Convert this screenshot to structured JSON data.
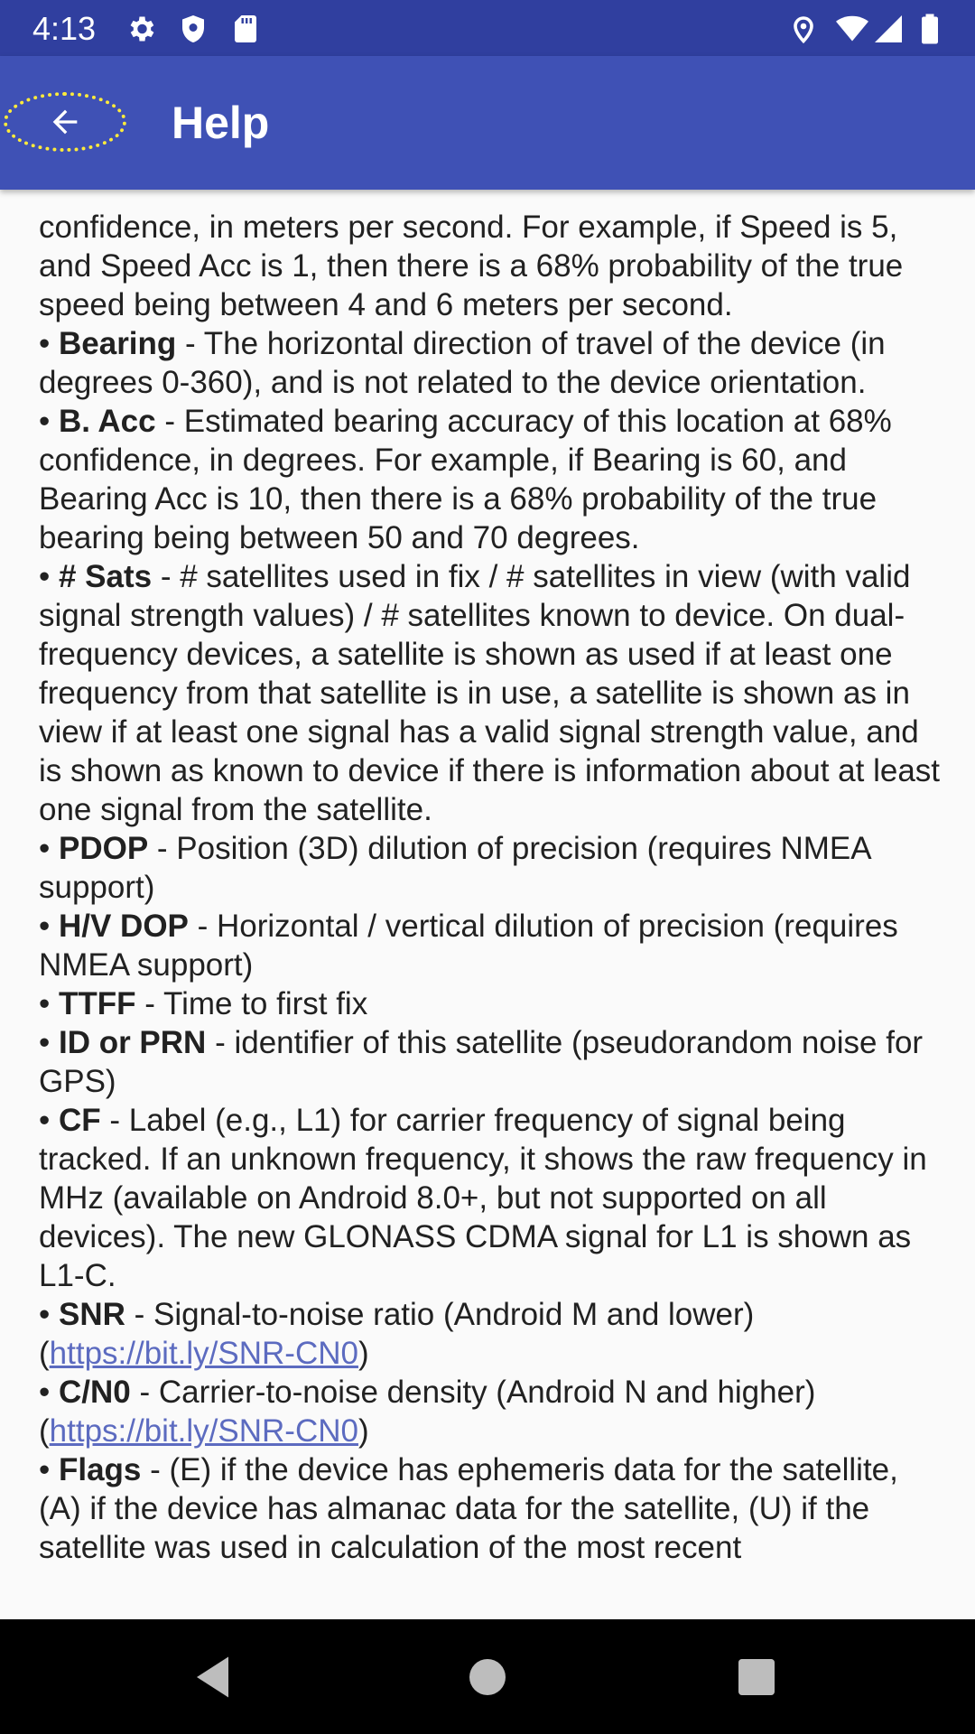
{
  "status_bar": {
    "time": "4:13",
    "left_icons": [
      "gear-icon",
      "shield-icon",
      "sd-card-icon"
    ],
    "right_icons": [
      "location-pin-icon",
      "wifi-icon",
      "cellular-signal-icon",
      "battery-icon"
    ]
  },
  "app_bar": {
    "title": "Help",
    "back_icon": "arrow-back-icon",
    "highlight_color": "#ffeb3b",
    "color": "#3f51b5"
  },
  "help": {
    "sacc_tail": "confidence, in meters per second. For example, if Speed is 5, and Speed Acc is 1, then there is a 68% probability of the true speed being between 4 and 6 meters per second.",
    "items": [
      {
        "term": "Bearing",
        "desc": " - The horizontal direction of travel of the device (in degrees 0-360), and is not related to the device orientation."
      },
      {
        "term": "B. Acc",
        "desc": " - Estimated bearing accuracy of this location at 68% confidence, in degrees. For example, if Bearing is 60, and Bearing Acc is 10, then there is a 68% probability of the true bearing being between 50 and 70 degrees."
      },
      {
        "term": "# Sats",
        "desc": " - # satellites used in fix / # satellites in view (with valid signal strength values) / # satellites known to device. On dual-frequency devices, a satellite is shown as used if at least one frequency from that satellite is in use, a satellite is shown as in view if at least one signal has a valid signal strength value, and is shown as known to device if there is information about at least one signal from the satellite."
      },
      {
        "term": "PDOP",
        "desc": " - Position (3D) dilution of precision (requires NMEA support)"
      },
      {
        "term": "H/V DOP",
        "desc": " - Horizontal / vertical dilution of precision (requires NMEA support)"
      },
      {
        "term": "TTFF",
        "desc": " - Time to first fix"
      },
      {
        "term": "ID or PRN",
        "desc": " - identifier of this satellite (pseudorandom noise for GPS)"
      },
      {
        "term": "CF",
        "desc": " - Label (e.g., L1) for carrier frequency of signal being tracked. If an unknown frequency, it shows the raw frequency in MHz (available on Android 8.0+, but not supported on all devices). The new GLONASS CDMA signal for L1 is shown as L1-C."
      },
      {
        "term": "SNR",
        "desc": " - Signal-to-noise ratio (Android M and lower)",
        "link": "https://bit.ly/SNR-CN0"
      },
      {
        "term": "C/N0",
        "desc": " - Carrier-to-noise density (Android N and higher)",
        "link": "https://bit.ly/SNR-CN0"
      },
      {
        "term": "Flags",
        "desc": " - (E) if the device has ephemeris data for the satellite, (A) if the device has almanac data for the satellite, (U) if the satellite was used in calculation of the most recent"
      }
    ]
  },
  "nav_bar": {
    "icons": [
      "back-triangle-icon",
      "home-circle-icon",
      "recents-square-icon"
    ]
  }
}
